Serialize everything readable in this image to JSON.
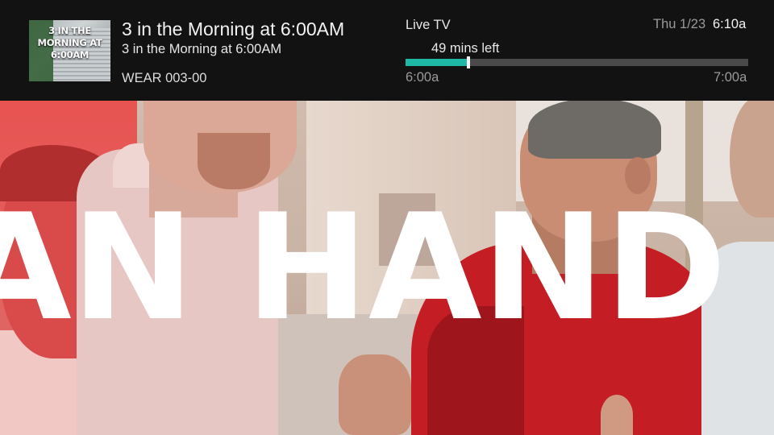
{
  "video": {
    "overlay_text": "AN HAND"
  },
  "program": {
    "thumbnail_text": "3 IN THE MORNING AT 6:00AM",
    "title": "3 in the Morning at 6:00AM",
    "episode": "3 in the Morning at 6:00AM",
    "channel": "WEAR 003-00"
  },
  "status": {
    "live_label": "Live TV",
    "date": "Thu 1/23",
    "time": "6:10a",
    "time_left": "49 mins left",
    "progress_fraction": 0.183,
    "start_time": "6:00a",
    "end_time": "7:00a"
  },
  "colors": {
    "bar_background": "#121212",
    "progress_fill": "#1fb7a6",
    "progress_track": "#4a4a4a"
  }
}
